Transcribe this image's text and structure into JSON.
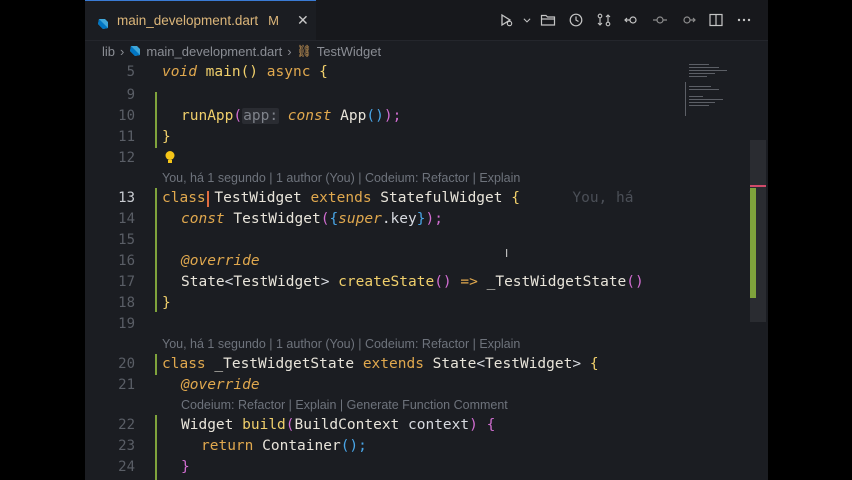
{
  "tab": {
    "filename": "main_development.dart",
    "modified": "M",
    "close": "✕"
  },
  "breadcrumb": {
    "folder": "lib",
    "file": "main_development.dart",
    "symbol": "TestWidget"
  },
  "lines": {
    "n5": "5",
    "n9": "9",
    "n10": "10",
    "n11": "11",
    "n12": "12",
    "n13": "13",
    "n14": "14",
    "n15": "15",
    "n16": "16",
    "n17": "17",
    "n18": "18",
    "n19": "19",
    "n20": "20",
    "n21": "21",
    "n22": "22",
    "n23": "23",
    "n24": "24"
  },
  "code": {
    "l5_void": "void",
    "l5_main": "main",
    "l5_paren": "()",
    "l5_async": "async",
    "l5_brace": "{",
    "l10_runApp": "runApp",
    "l10_open": "(",
    "l10_hint": "app:",
    "l10_const": "const",
    "l10_App": "App",
    "l10_call": "()",
    "l10_close": ");",
    "l11_brace": "}",
    "l13_class": "class",
    "l13_name": "TestWidget",
    "l13_extends": "extends",
    "l13_super": "StatefulWidget",
    "l13_brace": "{",
    "l13_blame": "You, há",
    "l14_const": "const",
    "l14_ctor": "TestWidget",
    "l14_open": "(",
    "l14_b1": "{",
    "l14_super": "super",
    "l14_key": ".key",
    "l14_b2": "}",
    "l14_end": ");",
    "l16_override": "@override",
    "l17_state": "State",
    "l17_lt": "<",
    "l17_type": "TestWidget",
    "l17_gt": ">",
    "l17_fn": "createState",
    "l17_paren": "()",
    "l17_arrow": "=>",
    "l17_cls": "_TestWidgetState",
    "l17_call": "()",
    "l18_brace": "}",
    "l20_class": "class",
    "l20_name": "_TestWidgetState",
    "l20_extends": "extends",
    "l20_state": "State",
    "l20_lt": "<",
    "l20_type": "TestWidget",
    "l20_gt": ">",
    "l20_brace": "{",
    "l21_override": "@override",
    "l22_widget": "Widget",
    "l22_build": "build",
    "l22_open": "(",
    "l22_ctx": "BuildContext",
    "l22_param": "context",
    "l22_close": ")",
    "l22_brace": "{",
    "l23_return": "return",
    "l23_container": "Container",
    "l23_call": "();",
    "l24_brace": "}"
  },
  "codelens": {
    "above13": "You, há 1 segundo | 1 author (You) | Codeium: Refactor | Explain",
    "above20": "You, há 1 segundo | 1 author (You) | Codeium: Refactor | Explain",
    "above22": "Codeium: Refactor | Explain | Generate Function Comment"
  },
  "icons": [
    "dart-icon",
    "run-debug-icon",
    "chevron-down-icon",
    "open-folder-icon",
    "history-icon",
    "compare-changes-icon",
    "go-back-icon",
    "toggle-icon",
    "go-forward-icon",
    "split-editor-icon",
    "more-actions-icon",
    "lightbulb-icon"
  ],
  "colors": {
    "accent": "#3a7bd5",
    "modified": "#dcb67a",
    "keyword": "#e0a84e",
    "function": "#f0cf6b",
    "bracket_purple": "#d16dd1",
    "bracket_blue": "#49a6e8",
    "git_added": "#7fa33c"
  }
}
